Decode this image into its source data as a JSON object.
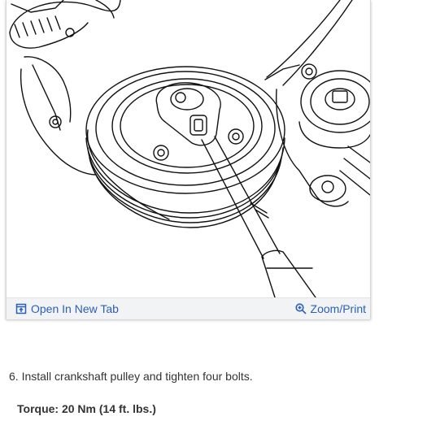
{
  "figure": {
    "open_tab_label": "Open In New Tab",
    "zoom_label": "Zoom/Print",
    "icons": {
      "open_tab": "open-in-new-tab-icon",
      "zoom": "zoom-in-icon"
    },
    "link_color": "#2a5fb8"
  },
  "instructions": {
    "step_text": "6. Install crankshaft pulley and tighten four bolts.",
    "torque_text": "Torque: 20 Nm (14 ft. lbs.)"
  }
}
